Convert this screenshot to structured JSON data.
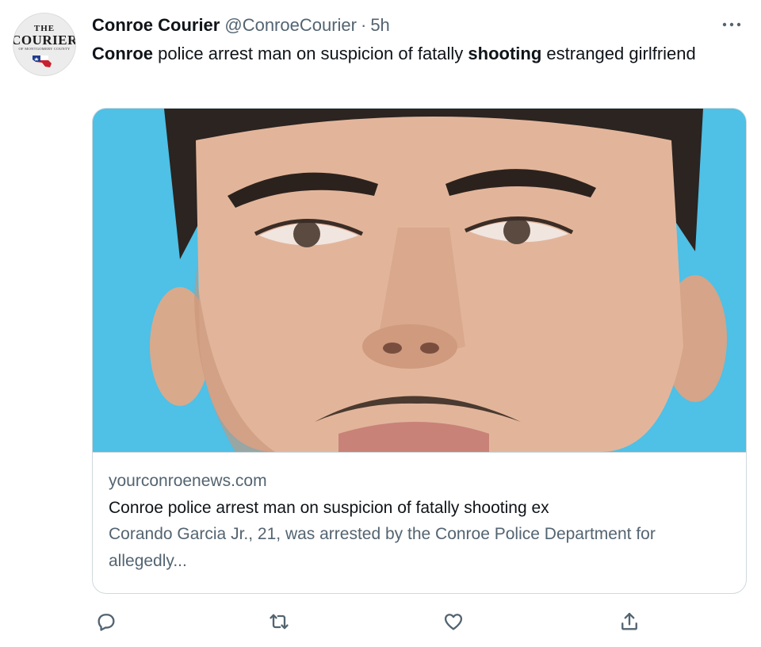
{
  "account": {
    "display_name": "Conroe Courier",
    "handle": "@ConroeCourier",
    "separator": "·",
    "time": "5h",
    "avatar": {
      "line1": "THE",
      "line2": "COURIER",
      "line3": "OF MONTGOMERY COUNTY"
    }
  },
  "tweet": {
    "text_parts": [
      {
        "text": "Conroe",
        "bold": true
      },
      {
        "text": " police arrest man on suspicion of fatally ",
        "bold": false
      },
      {
        "text": "shooting",
        "bold": true
      },
      {
        "text": " estranged girlfriend",
        "bold": false
      }
    ]
  },
  "card": {
    "domain": "yourconroenews.com",
    "title": "Conroe police arrest man on suspicion of fatally shooting ex",
    "description": "Corando Garcia Jr., 21, was arrested by the Conroe Police Department for allegedly...",
    "image_background": "#4fc0e6"
  },
  "actions": [
    {
      "name": "reply",
      "icon": "reply-icon"
    },
    {
      "name": "retweet",
      "icon": "retweet-icon"
    },
    {
      "name": "like",
      "icon": "like-icon"
    },
    {
      "name": "share",
      "icon": "share-icon"
    }
  ],
  "colors": {
    "text_primary": "#0f1419",
    "text_secondary": "#536471",
    "border": "#cfd9de"
  }
}
